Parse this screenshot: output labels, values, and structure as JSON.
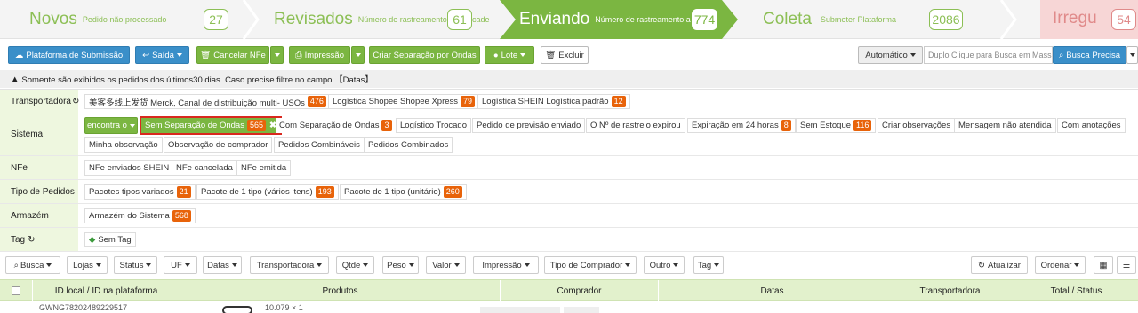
{
  "steps": [
    {
      "label": "Novos",
      "sub": "Pedido não processado",
      "count": "27"
    },
    {
      "label": "Revisados",
      "sub": "Número de rastreamento",
      "sub_tail": "cade",
      "count": "61"
    },
    {
      "label": "Enviando",
      "sub": "Número de rastreamento a",
      "count": "774"
    },
    {
      "label": "Coleta",
      "sub": "Submeter Plataforma",
      "count": "2086"
    },
    {
      "label": "Irregu",
      "count": "54"
    }
  ],
  "toolbar": {
    "submit": "Plataforma de Submissão",
    "saida": "Saída",
    "cancel_nfe": "Cancelar NFe",
    "print": "Impressão",
    "create_sep": "Criar Separação por Ondas",
    "lote": "Lote",
    "delete": "Excluir",
    "auto": "Automático",
    "search_placeholder": "Duplo Clique para Busca em Massa",
    "precise": "Busca Precisa"
  },
  "notice": "Somente são exibidos os pedidos dos últimos30 dias. Caso precise filtre no campo 【Datas】.",
  "filters": {
    "transportadora": {
      "label": "Transportadora",
      "tags": [
        {
          "text": "美客多线上发货 Merck, Canal de distribuição multi- USOs",
          "count": "476"
        },
        {
          "text": "Logística Shopee Shopee Xpress",
          "count": "79"
        },
        {
          "text": "Logística SHEIN Logística padrão",
          "count": "12"
        }
      ]
    },
    "sistema": {
      "label": "Sistema",
      "mode": "encontra o",
      "selected": {
        "text": "Sem Separação de Ondas",
        "count": "565"
      },
      "tags": [
        {
          "text": "Com Separação de Ondas",
          "count": "3"
        },
        {
          "text": "Logístico Trocado",
          "count": ""
        },
        {
          "text": "Pedido de previsão enviado",
          "count": ""
        },
        {
          "text": "O Nº de rastreio expirou",
          "count": ""
        },
        {
          "text": "Expiração em 24 horas",
          "count": "8"
        },
        {
          "text": "Sem Estoque",
          "count": "116"
        },
        {
          "text": "Criar observações",
          "count": ""
        },
        {
          "text": "Mensagem não atendida",
          "count": ""
        },
        {
          "text": "Com anotações",
          "count": ""
        }
      ],
      "tags2": [
        {
          "text": "Minha observação"
        },
        {
          "text": "Observação de comprador"
        },
        {
          "text": "Pedidos Combináveis"
        },
        {
          "text": "Pedidos Combinados"
        }
      ]
    },
    "nfe": {
      "label": "NFe",
      "tags": [
        {
          "text": "NFe enviados SHEIN"
        },
        {
          "text": "NFe cancelada"
        },
        {
          "text": "NFe emitida"
        }
      ]
    },
    "tipo": {
      "label": "Tipo de Pedidos",
      "tags": [
        {
          "text": "Pacotes tipos variados",
          "count": "21"
        },
        {
          "text": "Pacote de 1 tipo (vários itens)",
          "count": "193"
        },
        {
          "text": "Pacote de 1 tipo (unitário)",
          "count": "260"
        }
      ]
    },
    "armazem": {
      "label": "Armazém",
      "tags": [
        {
          "text": "Armazém do Sistema",
          "count": "568"
        }
      ]
    },
    "tag": {
      "label": "Tag",
      "tags": [
        {
          "text": "Sem Tag"
        }
      ]
    }
  },
  "filterbar": [
    "Busca",
    "Lojas",
    "Status",
    "UF",
    "Datas",
    "Transportadora",
    "Qtde",
    "Peso",
    "Valor",
    "Impressão",
    "Tipo de Comprador",
    "Outro",
    "Tag"
  ],
  "filterbar_right": {
    "refresh": "Atualizar",
    "order": "Ordenar"
  },
  "table": {
    "columns": [
      "ID local / ID na plataforma",
      "Produtos",
      "Comprador",
      "Datas",
      "Transportadora",
      "Total / Status"
    ],
    "first_row": {
      "id": "GWNG78202489229517",
      "qty": "10.079 × 1"
    }
  },
  "colors": {
    "accent_green": "#7bb641",
    "accent_blue": "#3a8fc9",
    "badge": "#e8630a",
    "selected_border": "#d9281e"
  }
}
